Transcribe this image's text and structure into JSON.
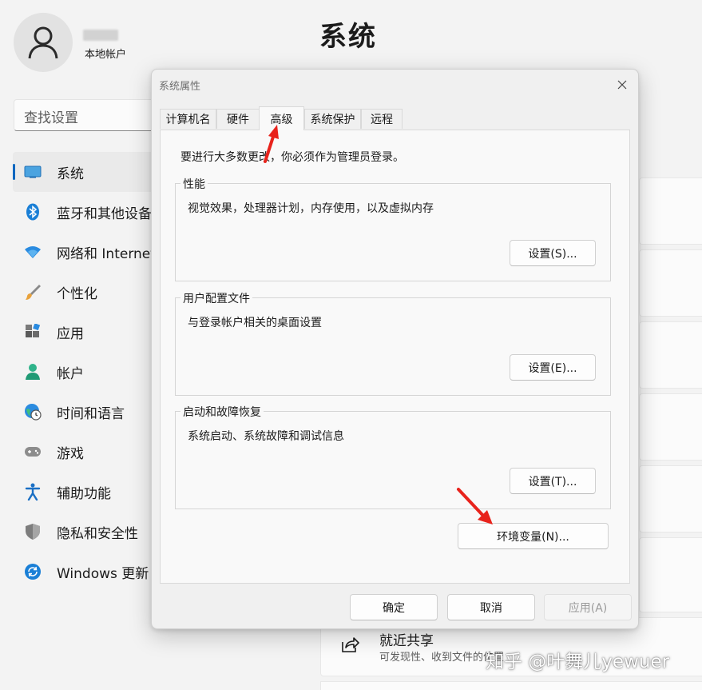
{
  "settings": {
    "user": {
      "subtitle": "本地帐户"
    },
    "page_title": "系统",
    "search": {
      "placeholder": "查找设置"
    },
    "nav": {
      "items": [
        {
          "label": "系统",
          "icon": "display-icon",
          "active": true
        },
        {
          "label": "蓝牙和其他设备",
          "icon": "bluetooth-icon"
        },
        {
          "label": "网络和 Internet",
          "icon": "wifi-icon"
        },
        {
          "label": "个性化",
          "icon": "brush-icon"
        },
        {
          "label": "应用",
          "icon": "apps-icon"
        },
        {
          "label": "帐户",
          "icon": "person-icon"
        },
        {
          "label": "时间和语言",
          "icon": "globe-clock-icon"
        },
        {
          "label": "游戏",
          "icon": "gamepad-icon"
        },
        {
          "label": "辅助功能",
          "icon": "accessibility-icon"
        },
        {
          "label": "隐私和安全性",
          "icon": "shield-icon"
        },
        {
          "label": "Windows 更新",
          "icon": "sync-icon"
        }
      ]
    },
    "nearby_share": {
      "title": "就近共享",
      "subtitle": "可发现性、收到文件的位置"
    },
    "watermark": "知乎 @叶舞儿yewuer"
  },
  "dialog": {
    "title": "系统属性",
    "tabs": [
      {
        "label": "计算机名"
      },
      {
        "label": "硬件"
      },
      {
        "label": "高级",
        "selected": true
      },
      {
        "label": "系统保护"
      },
      {
        "label": "远程"
      }
    ],
    "intro": "要进行大多数更改，你必须作为管理员登录。",
    "groups": {
      "performance": {
        "label": "性能",
        "description": "视觉效果，处理器计划，内存使用，以及虚拟内存",
        "button": "设置(S)..."
      },
      "profiles": {
        "label": "用户配置文件",
        "description": "与登录帐户相关的桌面设置",
        "button": "设置(E)..."
      },
      "startup": {
        "label": "启动和故障恢复",
        "description": "系统启动、系统故障和调试信息",
        "button": "设置(T)..."
      }
    },
    "env_button": "环境变量(N)...",
    "footer": {
      "ok": "确定",
      "cancel": "取消",
      "apply": "应用(A)"
    }
  },
  "colors": {
    "accent": "#0067c0",
    "annotation_arrow": "#e8231c"
  }
}
